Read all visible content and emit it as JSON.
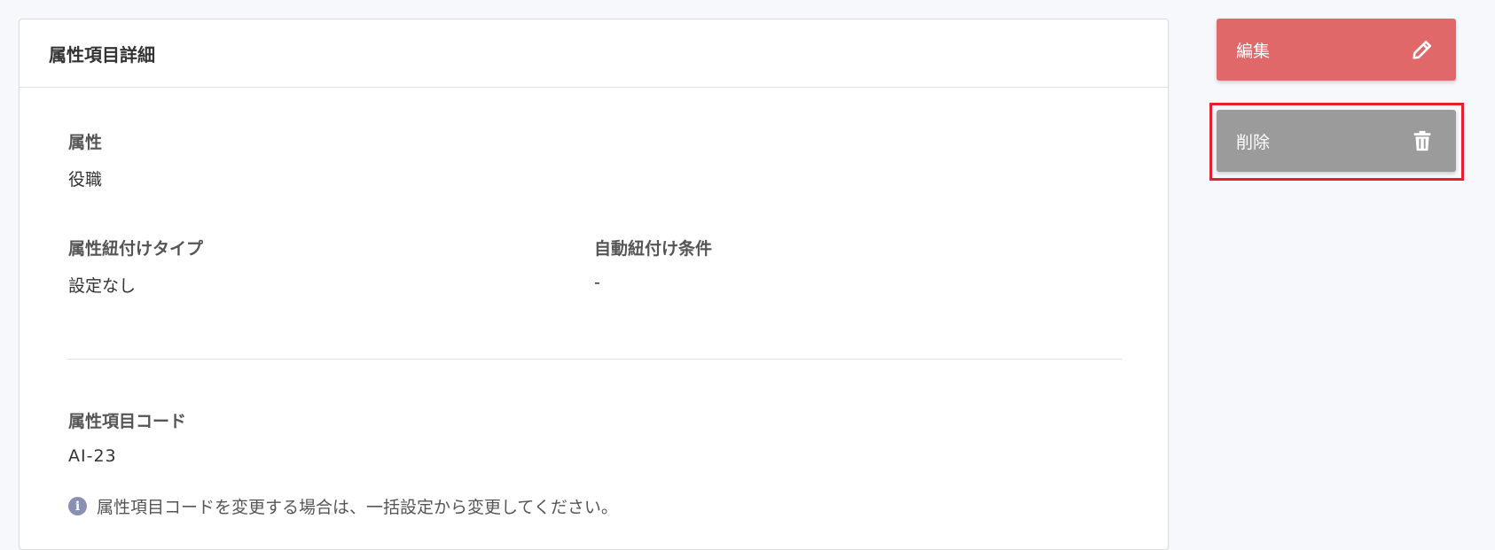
{
  "card": {
    "title": "属性項目詳細",
    "attribute": {
      "label": "属性",
      "value": "役職"
    },
    "link_type": {
      "label": "属性紐付けタイプ",
      "value": "設定なし"
    },
    "auto_condition": {
      "label": "自動紐付け条件",
      "value": "-"
    },
    "item_code": {
      "label": "属性項目コード",
      "value": "AI-23"
    },
    "info": {
      "icon": "info-icon",
      "text": "属性項目コードを変更する場合は、一括設定から変更してください。"
    }
  },
  "actions": {
    "edit": {
      "label": "編集",
      "icon": "pencil-icon",
      "color": "#e06869"
    },
    "delete": {
      "label": "削除",
      "icon": "trash-icon",
      "color": "#9b9b9b"
    }
  },
  "highlight": {
    "color": "#e3202b"
  }
}
